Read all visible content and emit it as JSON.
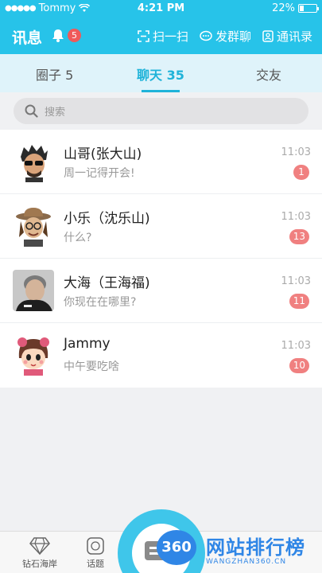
{
  "status_bar": {
    "carrier": "Tommy",
    "time": "4:21 PM",
    "battery": "22%"
  },
  "header": {
    "title": "讯息",
    "bell_badge": "5",
    "actions": [
      {
        "label": "扫一扫",
        "icon": "scan-icon"
      },
      {
        "label": "发群聊",
        "icon": "group-chat-icon"
      },
      {
        "label": "通讯录",
        "icon": "contacts-icon"
      }
    ]
  },
  "tabs": [
    {
      "label": "圈子 5",
      "active": false
    },
    {
      "label": "聊天 35",
      "active": true
    },
    {
      "label": "交友",
      "active": false
    }
  ],
  "search": {
    "placeholder": "搜索"
  },
  "chats": [
    {
      "name": "山哥(张大山)",
      "preview": "周一记得开会!",
      "time": "11:03",
      "unread": "1",
      "avatar": "avatar-man-sunglasses"
    },
    {
      "name": "小乐（沈乐山)",
      "preview": "什么?",
      "time": "11:03",
      "unread": "13",
      "avatar": "avatar-man-hat"
    },
    {
      "name": "大海（王海福)",
      "preview": "你现在在哪里?",
      "time": "11:03",
      "unread": "11",
      "avatar": "avatar-man-photo"
    },
    {
      "name": "Jammy",
      "preview": "中午要吃啥",
      "time": "11:03",
      "unread": "10",
      "avatar": "avatar-girl-cartoon"
    }
  ],
  "tab_bar": {
    "items": [
      {
        "label": "钻石海岸",
        "icon": "diamond-icon"
      },
      {
        "label": "话题",
        "icon": "topic-icon"
      }
    ]
  },
  "watermark": {
    "logo_text": "360",
    "brand": "网站排行榜",
    "domain": "WANGZHAN360.CN"
  },
  "colors": {
    "primary": "#27c3e9",
    "active_tab": "#1fb3d9",
    "badge": "#f08080",
    "bell_badge": "#ef5a5a"
  }
}
